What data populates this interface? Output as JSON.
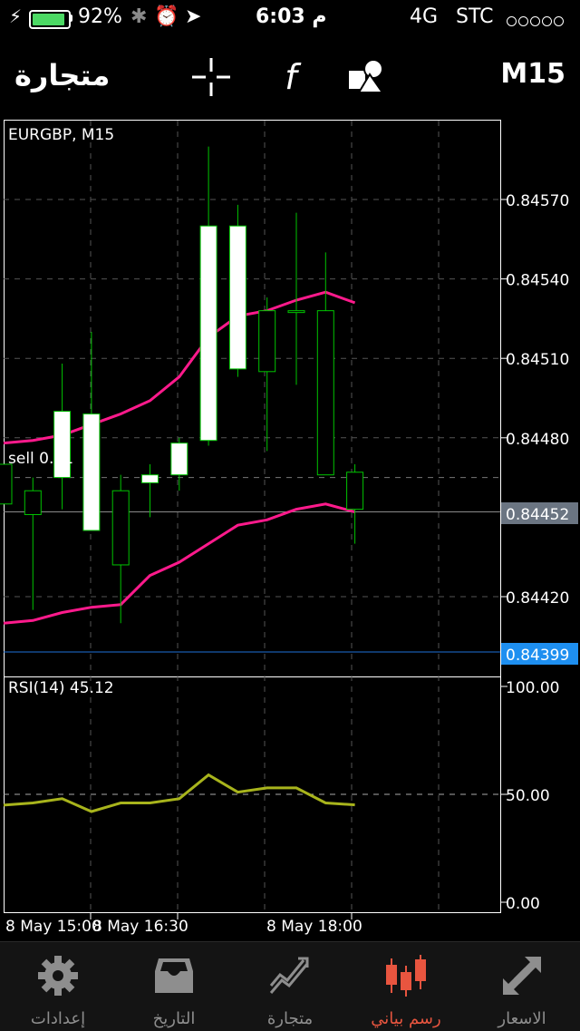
{
  "status": {
    "battery": "92%",
    "battery_level": 0.92,
    "time": "6:03 م",
    "network": "4G",
    "carrier": "STC",
    "signal_dots": 5
  },
  "toolbar": {
    "title": "متجارة",
    "timeframe": "M15",
    "crosshair_icon": "crosshair-icon",
    "indicators_icon": "function-icon",
    "objects_icon": "shapes-icon"
  },
  "chart": {
    "symbol_label": "EURGBP, M15",
    "order_label": "sell 0.01",
    "current_price": "0.84452",
    "order_price": "0.84399",
    "price_ticks": [
      "0.84570",
      "0.84540",
      "0.84510",
      "0.84480",
      "0.84420"
    ],
    "rsi_label": "RSI(14) 45.12",
    "rsi_ticks": [
      "100.00",
      "50.00",
      "0.00"
    ],
    "time_ticks": [
      "8 May 15:00",
      "8 May 16:30",
      "8 May 18:00"
    ],
    "colors": {
      "bull_body": "#ffffff",
      "wick": "#00c400",
      "bands": "#ff1a8c",
      "rsi_line": "#a8b41c",
      "order_line": "#1e6fd9",
      "current_tag": "#6b7582",
      "order_tag": "#1e8ff0"
    }
  },
  "chart_data": {
    "type": "candlestick",
    "symbol": "EURGBP",
    "timeframe": "M15",
    "x_ticks": [
      "8 May 15:00",
      "8 May 16:30",
      "8 May 18:00"
    ],
    "ylim": [
      0.84399,
      0.846
    ],
    "candles": [
      {
        "open": 0.8447,
        "close": 0.84455,
        "high": 0.8447,
        "low": 0.84455
      },
      {
        "open": 0.8446,
        "close": 0.84451,
        "high": 0.84465,
        "low": 0.84415
      },
      {
        "open": 0.84465,
        "close": 0.8449,
        "high": 0.84508,
        "low": 0.84453
      },
      {
        "open": 0.84445,
        "close": 0.84489,
        "high": 0.8452,
        "low": 0.84445
      },
      {
        "open": 0.8446,
        "close": 0.84432,
        "high": 0.84466,
        "low": 0.8441
      },
      {
        "open": 0.84463,
        "close": 0.84466,
        "high": 0.8447,
        "low": 0.8445
      },
      {
        "open": 0.84466,
        "close": 0.84478,
        "high": 0.8448,
        "low": 0.8446
      },
      {
        "open": 0.84479,
        "close": 0.8456,
        "high": 0.8459,
        "low": 0.84477
      },
      {
        "open": 0.84506,
        "close": 0.8456,
        "high": 0.84568,
        "low": 0.84503
      },
      {
        "open": 0.84528,
        "close": 0.84505,
        "high": 0.84533,
        "low": 0.84475
      },
      {
        "open": 0.84528,
        "close": 0.84528,
        "high": 0.84565,
        "low": 0.845
      },
      {
        "open": 0.84528,
        "close": 0.84466,
        "high": 0.8455,
        "low": 0.84466
      },
      {
        "open": 0.84467,
        "close": 0.84453,
        "high": 0.8447,
        "low": 0.8444
      }
    ],
    "upper_band": [
      0.84478,
      0.84479,
      0.84481,
      0.84485,
      0.84489,
      0.84494,
      0.84503,
      0.84518,
      0.84526,
      0.84528,
      0.84532,
      0.84535,
      0.84531
    ],
    "lower_band": [
      0.8441,
      0.84411,
      0.84414,
      0.84416,
      0.84417,
      0.84428,
      0.84433,
      0.8444,
      0.84447,
      0.84449,
      0.84453,
      0.84455,
      0.84452
    ],
    "order_level": 0.84399,
    "current_price": 0.84452,
    "rsi": {
      "name": "RSI(14)",
      "value": 45.12,
      "ylim": [
        0,
        100
      ],
      "values": [
        45,
        46,
        48,
        42,
        46,
        46,
        48,
        59,
        51,
        53,
        53,
        46,
        45.12
      ]
    }
  },
  "tabs": [
    {
      "label": "إعدادات",
      "icon": "gear-icon",
      "active": false
    },
    {
      "label": "التاريخ",
      "icon": "history-tray-icon",
      "active": false
    },
    {
      "label": "متجارة",
      "icon": "trade-chart-icon",
      "active": false
    },
    {
      "label": "رسم بياني",
      "icon": "candles-icon",
      "active": true
    },
    {
      "label": "الاسعار",
      "icon": "quotes-arrows-icon",
      "active": false
    }
  ]
}
